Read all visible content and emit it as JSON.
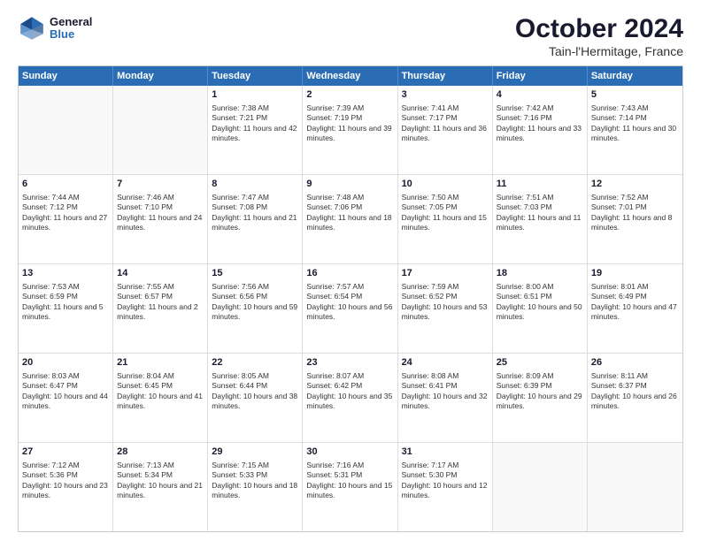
{
  "header": {
    "logo_line1": "General",
    "logo_line2": "Blue",
    "title": "October 2024",
    "subtitle": "Tain-l'Hermitage, France"
  },
  "days_of_week": [
    "Sunday",
    "Monday",
    "Tuesday",
    "Wednesday",
    "Thursday",
    "Friday",
    "Saturday"
  ],
  "weeks": [
    [
      {
        "day": "",
        "sunrise": "",
        "sunset": "",
        "daylight": ""
      },
      {
        "day": "",
        "sunrise": "",
        "sunset": "",
        "daylight": ""
      },
      {
        "day": "1",
        "sunrise": "Sunrise: 7:38 AM",
        "sunset": "Sunset: 7:21 PM",
        "daylight": "Daylight: 11 hours and 42 minutes."
      },
      {
        "day": "2",
        "sunrise": "Sunrise: 7:39 AM",
        "sunset": "Sunset: 7:19 PM",
        "daylight": "Daylight: 11 hours and 39 minutes."
      },
      {
        "day": "3",
        "sunrise": "Sunrise: 7:41 AM",
        "sunset": "Sunset: 7:17 PM",
        "daylight": "Daylight: 11 hours and 36 minutes."
      },
      {
        "day": "4",
        "sunrise": "Sunrise: 7:42 AM",
        "sunset": "Sunset: 7:16 PM",
        "daylight": "Daylight: 11 hours and 33 minutes."
      },
      {
        "day": "5",
        "sunrise": "Sunrise: 7:43 AM",
        "sunset": "Sunset: 7:14 PM",
        "daylight": "Daylight: 11 hours and 30 minutes."
      }
    ],
    [
      {
        "day": "6",
        "sunrise": "Sunrise: 7:44 AM",
        "sunset": "Sunset: 7:12 PM",
        "daylight": "Daylight: 11 hours and 27 minutes."
      },
      {
        "day": "7",
        "sunrise": "Sunrise: 7:46 AM",
        "sunset": "Sunset: 7:10 PM",
        "daylight": "Daylight: 11 hours and 24 minutes."
      },
      {
        "day": "8",
        "sunrise": "Sunrise: 7:47 AM",
        "sunset": "Sunset: 7:08 PM",
        "daylight": "Daylight: 11 hours and 21 minutes."
      },
      {
        "day": "9",
        "sunrise": "Sunrise: 7:48 AM",
        "sunset": "Sunset: 7:06 PM",
        "daylight": "Daylight: 11 hours and 18 minutes."
      },
      {
        "day": "10",
        "sunrise": "Sunrise: 7:50 AM",
        "sunset": "Sunset: 7:05 PM",
        "daylight": "Daylight: 11 hours and 15 minutes."
      },
      {
        "day": "11",
        "sunrise": "Sunrise: 7:51 AM",
        "sunset": "Sunset: 7:03 PM",
        "daylight": "Daylight: 11 hours and 11 minutes."
      },
      {
        "day": "12",
        "sunrise": "Sunrise: 7:52 AM",
        "sunset": "Sunset: 7:01 PM",
        "daylight": "Daylight: 11 hours and 8 minutes."
      }
    ],
    [
      {
        "day": "13",
        "sunrise": "Sunrise: 7:53 AM",
        "sunset": "Sunset: 6:59 PM",
        "daylight": "Daylight: 11 hours and 5 minutes."
      },
      {
        "day": "14",
        "sunrise": "Sunrise: 7:55 AM",
        "sunset": "Sunset: 6:57 PM",
        "daylight": "Daylight: 11 hours and 2 minutes."
      },
      {
        "day": "15",
        "sunrise": "Sunrise: 7:56 AM",
        "sunset": "Sunset: 6:56 PM",
        "daylight": "Daylight: 10 hours and 59 minutes."
      },
      {
        "day": "16",
        "sunrise": "Sunrise: 7:57 AM",
        "sunset": "Sunset: 6:54 PM",
        "daylight": "Daylight: 10 hours and 56 minutes."
      },
      {
        "day": "17",
        "sunrise": "Sunrise: 7:59 AM",
        "sunset": "Sunset: 6:52 PM",
        "daylight": "Daylight: 10 hours and 53 minutes."
      },
      {
        "day": "18",
        "sunrise": "Sunrise: 8:00 AM",
        "sunset": "Sunset: 6:51 PM",
        "daylight": "Daylight: 10 hours and 50 minutes."
      },
      {
        "day": "19",
        "sunrise": "Sunrise: 8:01 AM",
        "sunset": "Sunset: 6:49 PM",
        "daylight": "Daylight: 10 hours and 47 minutes."
      }
    ],
    [
      {
        "day": "20",
        "sunrise": "Sunrise: 8:03 AM",
        "sunset": "Sunset: 6:47 PM",
        "daylight": "Daylight: 10 hours and 44 minutes."
      },
      {
        "day": "21",
        "sunrise": "Sunrise: 8:04 AM",
        "sunset": "Sunset: 6:45 PM",
        "daylight": "Daylight: 10 hours and 41 minutes."
      },
      {
        "day": "22",
        "sunrise": "Sunrise: 8:05 AM",
        "sunset": "Sunset: 6:44 PM",
        "daylight": "Daylight: 10 hours and 38 minutes."
      },
      {
        "day": "23",
        "sunrise": "Sunrise: 8:07 AM",
        "sunset": "Sunset: 6:42 PM",
        "daylight": "Daylight: 10 hours and 35 minutes."
      },
      {
        "day": "24",
        "sunrise": "Sunrise: 8:08 AM",
        "sunset": "Sunset: 6:41 PM",
        "daylight": "Daylight: 10 hours and 32 minutes."
      },
      {
        "day": "25",
        "sunrise": "Sunrise: 8:09 AM",
        "sunset": "Sunset: 6:39 PM",
        "daylight": "Daylight: 10 hours and 29 minutes."
      },
      {
        "day": "26",
        "sunrise": "Sunrise: 8:11 AM",
        "sunset": "Sunset: 6:37 PM",
        "daylight": "Daylight: 10 hours and 26 minutes."
      }
    ],
    [
      {
        "day": "27",
        "sunrise": "Sunrise: 7:12 AM",
        "sunset": "Sunset: 5:36 PM",
        "daylight": "Daylight: 10 hours and 23 minutes."
      },
      {
        "day": "28",
        "sunrise": "Sunrise: 7:13 AM",
        "sunset": "Sunset: 5:34 PM",
        "daylight": "Daylight: 10 hours and 21 minutes."
      },
      {
        "day": "29",
        "sunrise": "Sunrise: 7:15 AM",
        "sunset": "Sunset: 5:33 PM",
        "daylight": "Daylight: 10 hours and 18 minutes."
      },
      {
        "day": "30",
        "sunrise": "Sunrise: 7:16 AM",
        "sunset": "Sunset: 5:31 PM",
        "daylight": "Daylight: 10 hours and 15 minutes."
      },
      {
        "day": "31",
        "sunrise": "Sunrise: 7:17 AM",
        "sunset": "Sunset: 5:30 PM",
        "daylight": "Daylight: 10 hours and 12 minutes."
      },
      {
        "day": "",
        "sunrise": "",
        "sunset": "",
        "daylight": ""
      },
      {
        "day": "",
        "sunrise": "",
        "sunset": "",
        "daylight": ""
      }
    ]
  ]
}
